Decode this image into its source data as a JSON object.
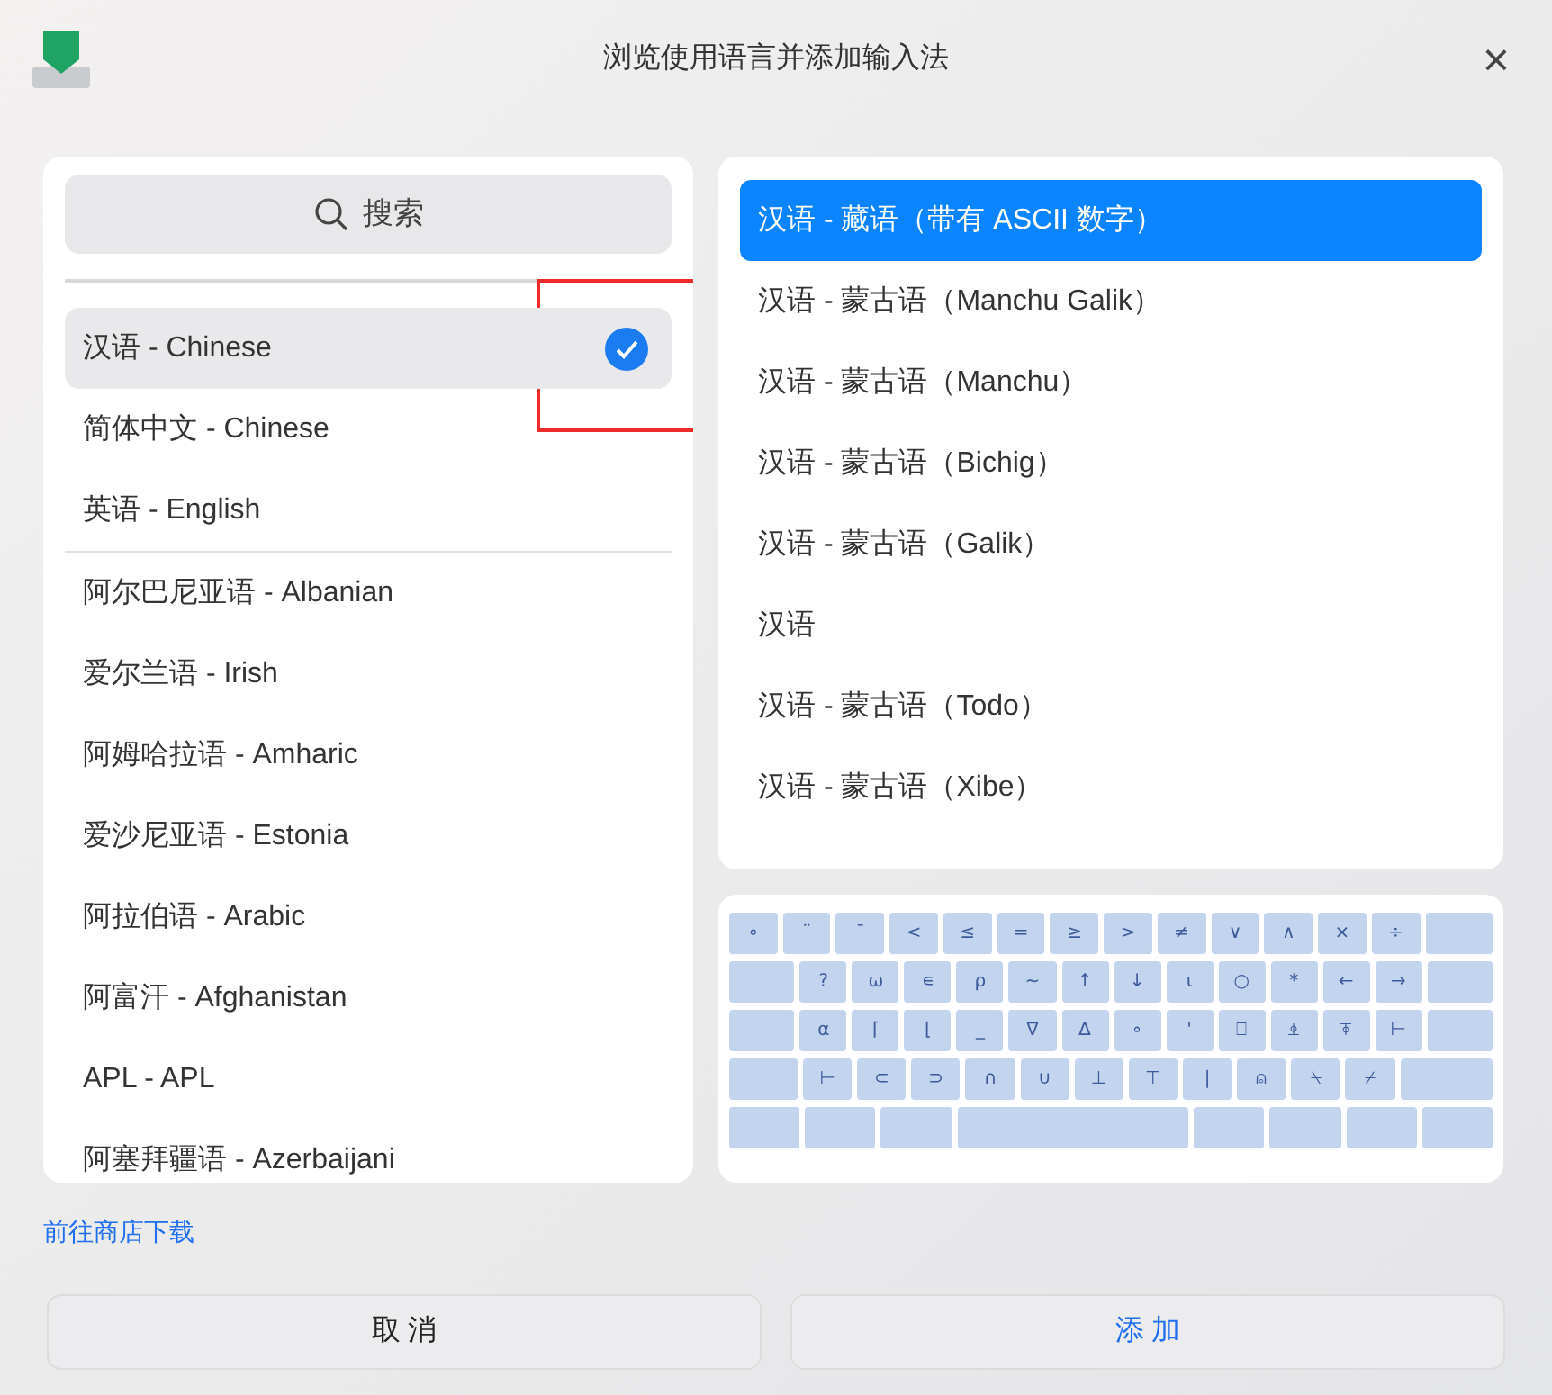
{
  "window": {
    "title": "浏览使用语言并添加输入法",
    "close": "×"
  },
  "search": {
    "placeholder": "搜索"
  },
  "recent_languages": [
    {
      "label": "汉语 - Chinese",
      "selected": true
    },
    {
      "label": "简体中文 - Chinese",
      "selected": false
    },
    {
      "label": "英语 - English",
      "selected": false
    }
  ],
  "languages": [
    {
      "label": "阿尔巴尼亚语 - Albanian",
      "selected": false
    },
    {
      "label": "爱尔兰语 - Irish",
      "selected": false
    },
    {
      "label": "阿姆哈拉语 - Amharic",
      "selected": false
    },
    {
      "label": "爱沙尼亚语 - Estonia",
      "selected": false
    },
    {
      "label": "阿拉伯语 - Arabic",
      "selected": false
    },
    {
      "label": "阿富汗 - Afghanistan",
      "selected": false
    },
    {
      "label": "APL - APL",
      "selected": false
    },
    {
      "label": "阿塞拜疆语 - Azerbaijani",
      "selected": false
    }
  ],
  "layouts": [
    {
      "label": "汉语 - 藏语（带有 ASCII 数字）",
      "selected": true
    },
    {
      "label": "汉语 - 蒙古语（Manchu Galik）",
      "selected": false
    },
    {
      "label": "汉语 - 蒙古语（Manchu）",
      "selected": false
    },
    {
      "label": "汉语 - 蒙古语（Bichig）",
      "selected": false
    },
    {
      "label": "汉语 - 蒙古语（Galik）",
      "selected": false
    },
    {
      "label": "汉语",
      "selected": false
    },
    {
      "label": "汉语 - 蒙古语（Todo）",
      "selected": false
    },
    {
      "label": "汉语 - 蒙古语（Xibe）",
      "selected": false
    }
  ],
  "keyboard": {
    "rows": [
      [
        {
          "kind": "key",
          "label": "∘"
        },
        {
          "kind": "key",
          "label": "¨"
        },
        {
          "kind": "key",
          "label": "¯"
        },
        {
          "kind": "key",
          "label": "<"
        },
        {
          "kind": "key",
          "label": "≤"
        },
        {
          "kind": "key",
          "label": "="
        },
        {
          "kind": "key",
          "label": "≥"
        },
        {
          "kind": "key",
          "label": ">"
        },
        {
          "kind": "key",
          "label": "≠"
        },
        {
          "kind": "key",
          "label": "∨"
        },
        {
          "kind": "key",
          "label": "∧"
        },
        {
          "kind": "key",
          "label": "×"
        },
        {
          "kind": "key",
          "label": "÷"
        },
        {
          "kind": "wide"
        }
      ],
      [
        {
          "kind": "wide"
        },
        {
          "kind": "key",
          "label": "?"
        },
        {
          "kind": "key",
          "label": "⍵"
        },
        {
          "kind": "key",
          "label": "∊"
        },
        {
          "kind": "key",
          "label": "⍴"
        },
        {
          "kind": "key",
          "label": "~"
        },
        {
          "kind": "key",
          "label": "↑"
        },
        {
          "kind": "key",
          "label": "↓"
        },
        {
          "kind": "key",
          "label": "⍳"
        },
        {
          "kind": "key",
          "label": "○"
        },
        {
          "kind": "key",
          "label": "*"
        },
        {
          "kind": "key",
          "label": "←"
        },
        {
          "kind": "key",
          "label": "→"
        },
        {
          "kind": "wide"
        }
      ],
      [
        {
          "kind": "wide"
        },
        {
          "kind": "key",
          "label": "⍺"
        },
        {
          "kind": "key",
          "label": "⌈"
        },
        {
          "kind": "key",
          "label": "⌊"
        },
        {
          "kind": "key",
          "label": "_"
        },
        {
          "kind": "key",
          "label": "∇"
        },
        {
          "kind": "key",
          "label": "∆"
        },
        {
          "kind": "key",
          "label": "∘"
        },
        {
          "kind": "key",
          "label": "'"
        },
        {
          "kind": "key",
          "label": "⎕"
        },
        {
          "kind": "key",
          "label": "⍎"
        },
        {
          "kind": "key",
          "label": "⍕"
        },
        {
          "kind": "key",
          "label": "⊢"
        },
        {
          "kind": "wide"
        }
      ],
      [
        {
          "kind": "wide"
        },
        {
          "kind": "key",
          "label": "⊢"
        },
        {
          "kind": "key",
          "label": "⊂"
        },
        {
          "kind": "key",
          "label": "⊃"
        },
        {
          "kind": "key",
          "label": "∩"
        },
        {
          "kind": "key",
          "label": "∪"
        },
        {
          "kind": "key",
          "label": "⊥"
        },
        {
          "kind": "key",
          "label": "⊤"
        },
        {
          "kind": "key",
          "label": "|"
        },
        {
          "kind": "key",
          "label": "⍝"
        },
        {
          "kind": "key",
          "label": "⍀"
        },
        {
          "kind": "key",
          "label": "⌿"
        },
        {
          "kind": "wider"
        }
      ],
      [
        {
          "kind": "wide"
        },
        {
          "kind": "wide"
        },
        {
          "kind": "wide"
        },
        {
          "kind": "space"
        },
        {
          "kind": "wide"
        },
        {
          "kind": "wide"
        },
        {
          "kind": "wide"
        },
        {
          "kind": "wide"
        }
      ]
    ]
  },
  "store_link": "前往商店下载",
  "buttons": [
    {
      "label": "取 消",
      "kind": "cancel"
    },
    {
      "label": "添 加",
      "kind": "add"
    }
  ]
}
